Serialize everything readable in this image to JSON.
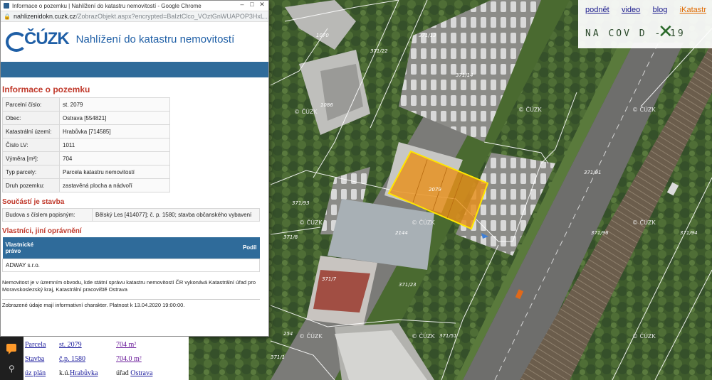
{
  "browser": {
    "window_title": "Informace o pozemku | Nahlížení do katastru nemovitostí - Google Chrome",
    "url_domain": "nahlizenidokn.cuzk.cz",
    "url_path": "/ZobrazObjekt.aspx?encrypted=BaIztClco_VOztGnWUAPOP3HxL..."
  },
  "site": {
    "logo_text": "ČÚZK",
    "title": "Nahlížení do katastru nemovitostí"
  },
  "pozemek": {
    "heading": "Informace o pozemku",
    "rows": [
      {
        "label": "Parcelní číslo:",
        "value": "st. 2079"
      },
      {
        "label": "Obec:",
        "value": "Ostrava [554821]"
      },
      {
        "label": "Katastrální území:",
        "value": "Hrabůvka [714585]"
      },
      {
        "label": "Číslo LV:",
        "value": "1011"
      },
      {
        "label": "Výměra [m²]:",
        "value": "704"
      },
      {
        "label": "Typ parcely:",
        "value": "Parcela katastru nemovitostí"
      },
      {
        "label": "Druh pozemku:",
        "value": "zastavěná plocha a nádvoří"
      }
    ]
  },
  "stavba": {
    "heading": "Součástí je stavba",
    "label": "Budova s číslem popisným:",
    "value": "Bělský Les [414077]; č. p. 1580; stavba občanského vybavení"
  },
  "vlastnici": {
    "heading": "Vlastníci, jiní oprávnění",
    "col1": "Vlastnické právo",
    "col2": "Podíl",
    "owner": "ADWAY s.r.o."
  },
  "notes": {
    "note1": "Nemovitost je v územním obvodu, kde státní správu katastru nemovitostí ČR vykonává Katastrální úřad pro Moravskoslezský kraj, Katastrální pracoviště Ostrava",
    "note2": "Zobrazené údaje mají informativní charakter. Platnost k 13.04.2020 19:00:00."
  },
  "top_links": {
    "items": [
      "podnět",
      "video",
      "blog",
      "iKatastr"
    ],
    "banner": "NA COV D - 19"
  },
  "parcel_strip": {
    "row1": {
      "type": "Parcela",
      "id": "st. 2079",
      "area": "704 m²"
    },
    "row2": {
      "type": "Stavba",
      "id": "č.p. 1580",
      "area": "704.0 m²"
    },
    "row3": {
      "type": "úz plán",
      "ku_prefix": "k.ú.",
      "ku": "Hrabůvka",
      "office_prefix": "úřad",
      "office": "Ostrava"
    }
  },
  "map": {
    "highlight_parcel": "2079",
    "parcel_labels": [
      "1070",
      "371/22",
      "371/13",
      "371/14",
      "1086",
      "371/91",
      "371/93",
      "371/96",
      "371/8",
      "2144",
      "371/23",
      "371/51",
      "371/1",
      "254",
      "371/94",
      "371/7"
    ],
    "watermark": "© ČÚZK",
    "colors": {
      "highlight_fill": "#e8901c",
      "highlight_stroke": "#ffe600",
      "parcel_line": "#ffffff"
    }
  }
}
